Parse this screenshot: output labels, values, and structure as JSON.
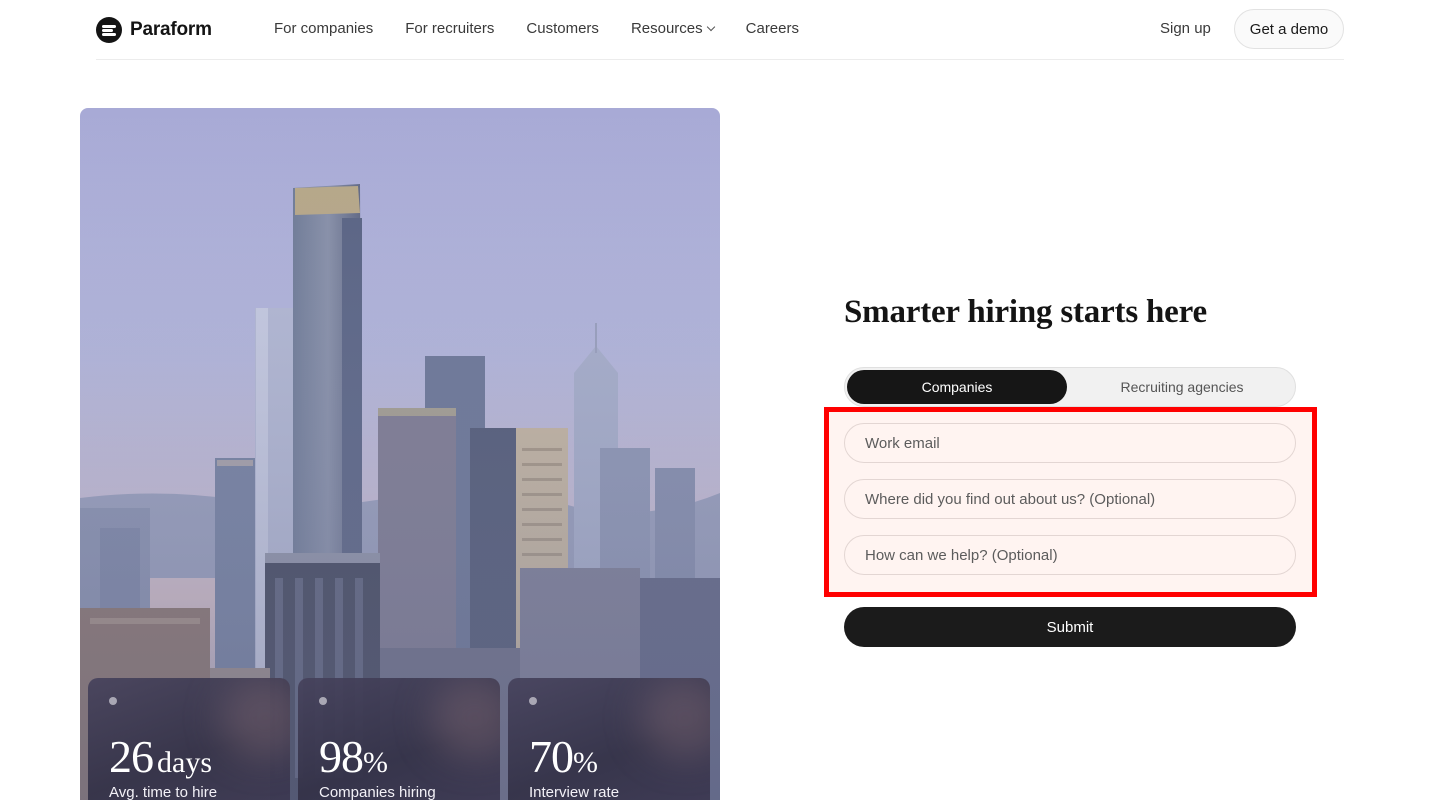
{
  "brand": {
    "name": "Paraform"
  },
  "nav": {
    "links": [
      "For companies",
      "For recruiters",
      "Customers",
      "Resources",
      "Careers"
    ],
    "signup": "Sign up",
    "demo": "Get a demo"
  },
  "stats": [
    {
      "value": "26",
      "unit": "days",
      "label": "Avg. time to hire"
    },
    {
      "value": "98",
      "unit": "%",
      "label": "Companies hiring"
    },
    {
      "value": "70",
      "unit": "%",
      "label": "Interview rate"
    }
  ],
  "form": {
    "title": "Smarter hiring starts here",
    "tabs": {
      "active": "Companies",
      "other": "Recruiting agencies"
    },
    "email_placeholder": "Work email",
    "source_placeholder": "Where did you find out about us? (Optional)",
    "help_placeholder": "How can we help? (Optional)",
    "submit": "Submit"
  },
  "colors": {
    "highlight": "#ff0000",
    "dark": "#161616",
    "field_bg": "#fff4f1"
  }
}
